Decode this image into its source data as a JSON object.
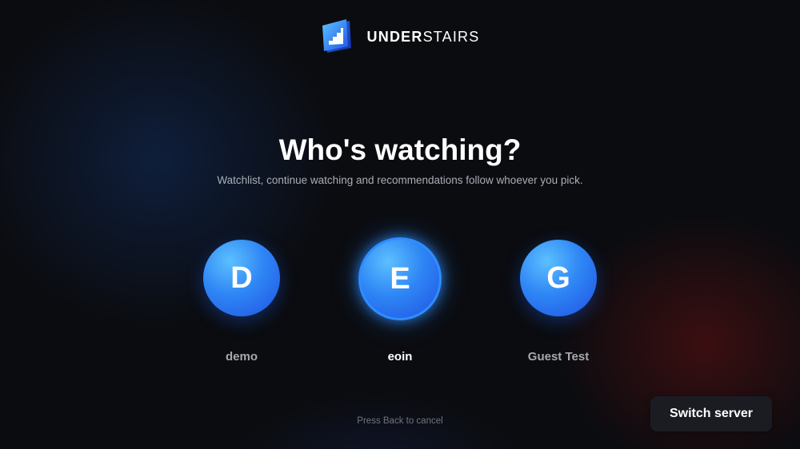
{
  "brand": {
    "name_bold": "UNDER",
    "name_light": "STAIRS",
    "logo_icon": "stairs-icon"
  },
  "heading": {
    "title": "Who's watching?",
    "subtitle": "Watchlist, continue watching and recommendations follow whoever you pick."
  },
  "profiles": [
    {
      "initial": "D",
      "name": "demo",
      "selected": false
    },
    {
      "initial": "E",
      "name": "eoin",
      "selected": true
    },
    {
      "initial": "G",
      "name": "Guest Test",
      "selected": false
    }
  ],
  "hint": "Press Back to cancel",
  "actions": {
    "switch_server": "Switch server"
  },
  "colors": {
    "accent": "#2f8dff",
    "avatar_light": "#5cc0ff",
    "avatar_dark": "#1f52e3",
    "background": "#0b0c10",
    "button_bg": "#1a1c22"
  }
}
